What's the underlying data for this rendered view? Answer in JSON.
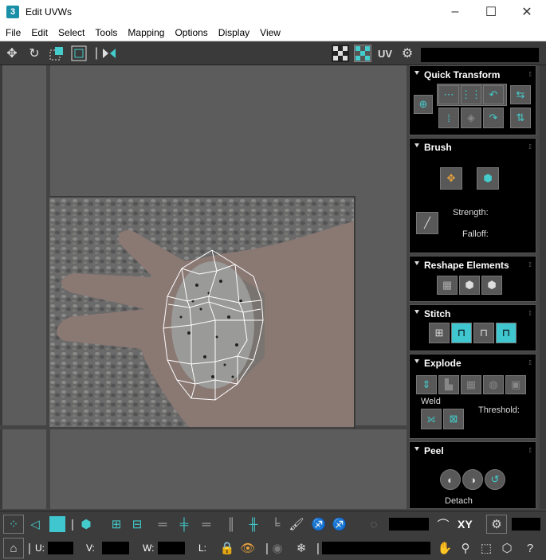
{
  "window": {
    "title": "Edit UVWs",
    "app_icon": "3",
    "minimize": "–",
    "maximize": "☐",
    "close": "✕"
  },
  "menu": [
    "File",
    "Edit",
    "Select",
    "Tools",
    "Mapping",
    "Options",
    "Display",
    "View"
  ],
  "toolbar": {
    "uv_label": "UV"
  },
  "panel": {
    "quick_transform": {
      "title": "Quick Transform"
    },
    "brush": {
      "title": "Brush",
      "strength_label": "Strength:",
      "falloff_label": "Falloff:"
    },
    "reshape": {
      "title": "Reshape Elements"
    },
    "stitch": {
      "title": "Stitch"
    },
    "explode": {
      "title": "Explode",
      "weld_label": "Weld",
      "threshold_label": "Threshold:"
    },
    "peel": {
      "title": "Peel",
      "detach_label": "Detach"
    }
  },
  "bottom": {
    "xy_label": "XY",
    "u_label": "U:",
    "v_label": "V:",
    "w_label": "W:",
    "l_label": "L:"
  },
  "colors": {
    "accent": "#3fc6cf",
    "rollout_bg": "#000000",
    "viewport_bg": "#5c5c5c"
  }
}
